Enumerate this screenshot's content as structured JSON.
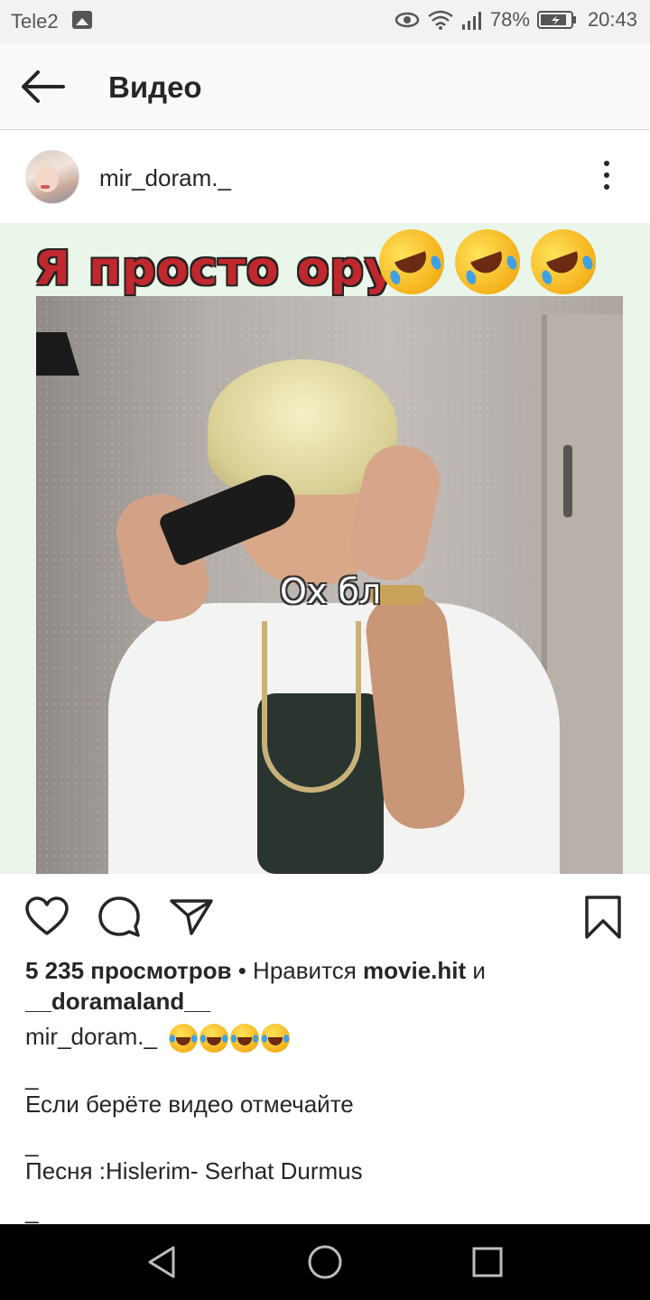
{
  "status_bar": {
    "carrier": "Tele2",
    "battery": "78%",
    "time": "20:43"
  },
  "header": {
    "title": "Видео"
  },
  "post": {
    "username": "mir_doram._",
    "media": {
      "overlay_title": "Я просто ору",
      "subtitle": "Ох бл"
    },
    "views": "5 235 просмотров",
    "likes_prefix": "• Нравится",
    "liked_by_1": "movie.hit",
    "liked_and": "и",
    "liked_by_2": "__doramaland__",
    "caption_author": "mir_doram._",
    "caption_lines": [
      "_",
      "Если берёте видео отмечайте",
      "_",
      "Песня :Hislerim- Serhat Durmus",
      "_"
    ]
  },
  "icons": {
    "back": "arrow-left-icon",
    "more": "more-vertical-icon",
    "like": "heart-icon",
    "comment": "comment-icon",
    "share": "send-icon",
    "save": "bookmark-icon"
  }
}
